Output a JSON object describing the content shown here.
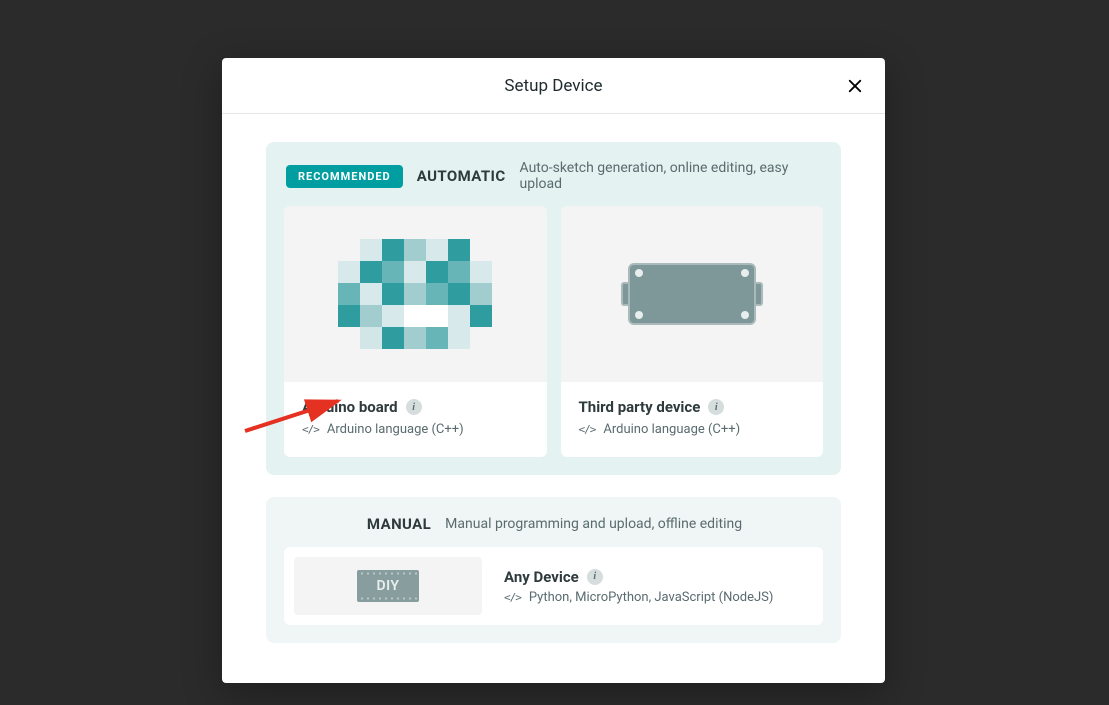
{
  "modal": {
    "title": "Setup Device"
  },
  "auto": {
    "badge": "RECOMMENDED",
    "title": "AUTOMATIC",
    "description": "Auto-sketch generation, online editing, easy upload",
    "cards": [
      {
        "title": "Arduino board",
        "language": "Arduino language (C++)"
      },
      {
        "title": "Third party device",
        "language": "Arduino language (C++)"
      }
    ]
  },
  "manual": {
    "title": "MANUAL",
    "description": "Manual programming and upload, offline editing",
    "card": {
      "title": "Any Device",
      "diy_label": "DIY",
      "language": "Python, MicroPython, JavaScript (NodeJS)"
    }
  },
  "pixel_colors": [
    [
      "#f4f4f4",
      "#d7e9ea",
      "#2f9da0",
      "#a1cdcf",
      "#d7e9ea",
      "#2f9da0",
      "#f4f4f4"
    ],
    [
      "#d7e9ea",
      "#2f9da0",
      "#68b5b7",
      "#d7e9ea",
      "#2f9da0",
      "#68b5b7",
      "#d7e9ea"
    ],
    [
      "#68b5b7",
      "#d7e9ea",
      "#2f9da0",
      "#a1cdcf",
      "#68b5b7",
      "#2f9da0",
      "#a1cdcf"
    ],
    [
      "#2f9da0",
      "#a1cdcf",
      "#d7e9ea",
      "#ffffff",
      "#ffffff",
      "#d7e9ea",
      "#2f9da0"
    ],
    [
      "#f4f4f4",
      "#d2e6e7",
      "#2f9da0",
      "#a1cdcf",
      "#68b5b7",
      "#d7e9ea",
      "#f4f4f4"
    ]
  ]
}
